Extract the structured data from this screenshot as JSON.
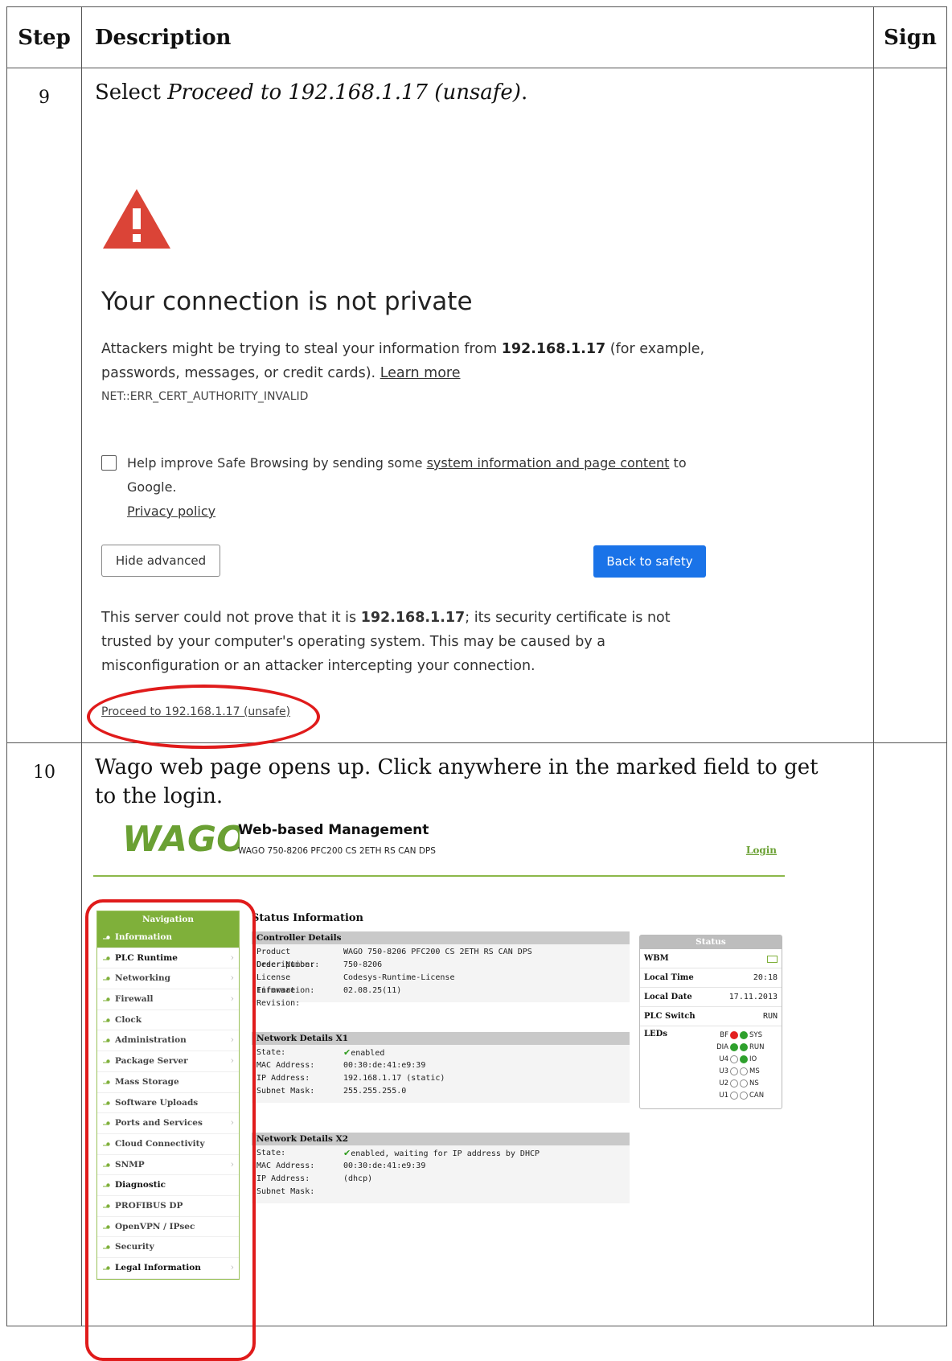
{
  "table": {
    "headers": {
      "step": "Step",
      "description": "Description",
      "sign": "Sign"
    }
  },
  "step9": {
    "number": "9",
    "instruction_prefix": "Select ",
    "instruction_italic": "Proceed to 192.168.1.17 (unsafe)",
    "instruction_suffix": ".",
    "warning": {
      "title": "Your connection is not private",
      "body_pre": "Attackers might be trying to steal your information from ",
      "body_host": "192.168.1.17",
      "body_post": " (for example, passwords, messages, or credit cards). ",
      "learn_more": "Learn more",
      "error_code": "NET::ERR_CERT_AUTHORITY_INVALID",
      "checkbox_pre": "Help improve Safe Browsing by sending some ",
      "checkbox_link": "system information and page content",
      "checkbox_post": " to Google.",
      "privacy_policy": "Privacy policy",
      "hide_advanced": "Hide advanced",
      "back_to_safety": "Back to safety",
      "server_pre": "This server could not prove that it is ",
      "server_host": "192.168.1.17",
      "server_post": "; its security certificate is not trusted by your computer's operating system. This may be caused by a misconfiguration or an attacker intercepting your connection.",
      "proceed": "Proceed to 192.168.1.17 (unsafe)"
    }
  },
  "step10": {
    "number": "10",
    "instruction": "Wago web page opens up. Click anywhere in the marked field to get to the login.",
    "wago": {
      "logo_text": "WAGO",
      "title": "Web-based Management",
      "subtitle": "WAGO 750-8206 PFC200 CS 2ETH RS CAN DPS",
      "login": "Login",
      "nav_title": "Navigation",
      "nav": [
        {
          "label": "Information",
          "chev": ""
        },
        {
          "label": "PLC Runtime",
          "chev": "›"
        },
        {
          "label": "Networking",
          "chev": "›"
        },
        {
          "label": "Firewall",
          "chev": "›"
        },
        {
          "label": "Clock",
          "chev": ""
        },
        {
          "label": "Administration",
          "chev": "›"
        },
        {
          "label": "Package Server",
          "chev": "›"
        },
        {
          "label": "Mass Storage",
          "chev": ""
        },
        {
          "label": "Software Uploads",
          "chev": ""
        },
        {
          "label": "Ports and Services",
          "chev": "›"
        },
        {
          "label": "Cloud Connectivity",
          "chev": ""
        },
        {
          "label": "SNMP",
          "chev": "›"
        },
        {
          "label": "Diagnostic",
          "chev": ""
        },
        {
          "label": "PROFIBUS DP",
          "chev": ""
        },
        {
          "label": "OpenVPN / IPsec",
          "chev": ""
        },
        {
          "label": "Security",
          "chev": ""
        },
        {
          "label": "Legal Information",
          "chev": "›"
        }
      ],
      "status_info_title": "Status Information",
      "controller": {
        "title": "Controller Details",
        "rows": [
          {
            "k": "Product Description:",
            "v": "WAGO 750-8206 PFC200 CS 2ETH RS CAN DPS"
          },
          {
            "k": "Order Number:",
            "v": "750-8206"
          },
          {
            "k": "License Information:",
            "v": "Codesys-Runtime-License"
          },
          {
            "k": "Firmware Revision:",
            "v": "02.08.25(11)"
          }
        ]
      },
      "x1": {
        "title": "Network Details X1",
        "rows": [
          {
            "k": "State:",
            "v": "enabled",
            "check": "✔"
          },
          {
            "k": "MAC Address:",
            "v": "00:30:de:41:e9:39"
          },
          {
            "k": "IP Address:",
            "v": "192.168.1.17 (static)"
          },
          {
            "k": "Subnet Mask:",
            "v": "255.255.255.0"
          }
        ]
      },
      "x2": {
        "title": "Network Details X2",
        "rows": [
          {
            "k": "State:",
            "v": "enabled, waiting for IP address by DHCP",
            "check": "✔"
          },
          {
            "k": "MAC Address:",
            "v": "00:30:de:41:e9:39"
          },
          {
            "k": "IP Address:",
            "v": "(dhcp)"
          },
          {
            "k": "Subnet Mask:",
            "v": ""
          }
        ]
      },
      "status": {
        "title": "Status",
        "wbm": "WBM",
        "local_time_label": "Local Time",
        "local_time": "20:18",
        "local_date_label": "Local Date",
        "local_date": "17.11.2013",
        "plc_switch_label": "PLC Switch",
        "plc_switch": "RUN",
        "leds_label": "LEDs",
        "leds": [
          {
            "l": "BF",
            "lc": "red",
            "r": "SYS",
            "rc": "green"
          },
          {
            "l": "DIA",
            "lc": "green",
            "r": "RUN",
            "rc": "green"
          },
          {
            "l": "U4",
            "lc": "off",
            "r": "IO",
            "rc": "green"
          },
          {
            "l": "U3",
            "lc": "off",
            "r": "MS",
            "rc": "off"
          },
          {
            "l": "U2",
            "lc": "off",
            "r": "NS",
            "rc": "off"
          },
          {
            "l": "U1",
            "lc": "off",
            "r": "CAN",
            "rc": "off"
          }
        ]
      }
    }
  },
  "colors": {
    "accent_red": "#e01b1b",
    "wago_green": "#7fb03a",
    "chrome_blue": "#1a73e8"
  }
}
